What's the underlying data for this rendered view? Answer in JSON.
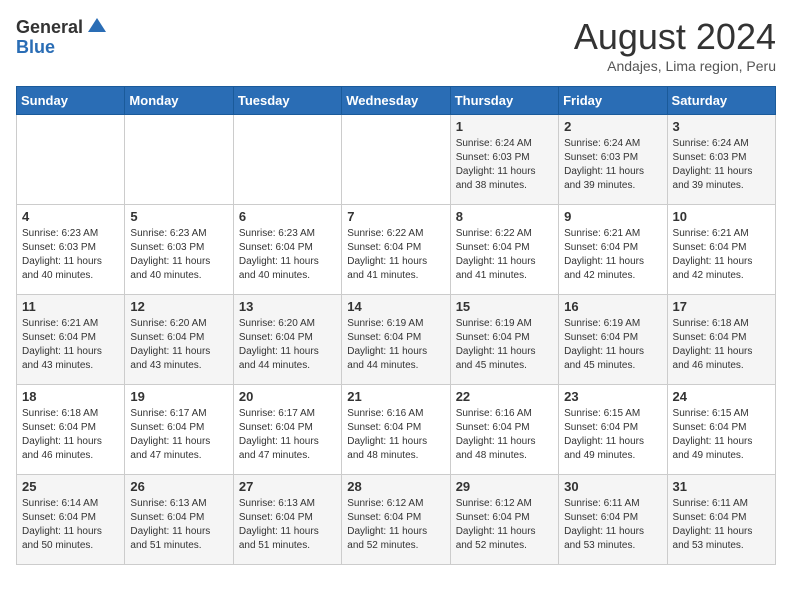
{
  "header": {
    "logo": {
      "line1": "General",
      "line2": "Blue"
    },
    "title": "August 2024",
    "location": "Andajes, Lima region, Peru"
  },
  "weekdays": [
    "Sunday",
    "Monday",
    "Tuesday",
    "Wednesday",
    "Thursday",
    "Friday",
    "Saturday"
  ],
  "weeks": [
    [
      {
        "day": "",
        "info": ""
      },
      {
        "day": "",
        "info": ""
      },
      {
        "day": "",
        "info": ""
      },
      {
        "day": "",
        "info": ""
      },
      {
        "day": "1",
        "info": "Sunrise: 6:24 AM\nSunset: 6:03 PM\nDaylight: 11 hours\nand 38 minutes."
      },
      {
        "day": "2",
        "info": "Sunrise: 6:24 AM\nSunset: 6:03 PM\nDaylight: 11 hours\nand 39 minutes."
      },
      {
        "day": "3",
        "info": "Sunrise: 6:24 AM\nSunset: 6:03 PM\nDaylight: 11 hours\nand 39 minutes."
      }
    ],
    [
      {
        "day": "4",
        "info": "Sunrise: 6:23 AM\nSunset: 6:03 PM\nDaylight: 11 hours\nand 40 minutes."
      },
      {
        "day": "5",
        "info": "Sunrise: 6:23 AM\nSunset: 6:03 PM\nDaylight: 11 hours\nand 40 minutes."
      },
      {
        "day": "6",
        "info": "Sunrise: 6:23 AM\nSunset: 6:04 PM\nDaylight: 11 hours\nand 40 minutes."
      },
      {
        "day": "7",
        "info": "Sunrise: 6:22 AM\nSunset: 6:04 PM\nDaylight: 11 hours\nand 41 minutes."
      },
      {
        "day": "8",
        "info": "Sunrise: 6:22 AM\nSunset: 6:04 PM\nDaylight: 11 hours\nand 41 minutes."
      },
      {
        "day": "9",
        "info": "Sunrise: 6:21 AM\nSunset: 6:04 PM\nDaylight: 11 hours\nand 42 minutes."
      },
      {
        "day": "10",
        "info": "Sunrise: 6:21 AM\nSunset: 6:04 PM\nDaylight: 11 hours\nand 42 minutes."
      }
    ],
    [
      {
        "day": "11",
        "info": "Sunrise: 6:21 AM\nSunset: 6:04 PM\nDaylight: 11 hours\nand 43 minutes."
      },
      {
        "day": "12",
        "info": "Sunrise: 6:20 AM\nSunset: 6:04 PM\nDaylight: 11 hours\nand 43 minutes."
      },
      {
        "day": "13",
        "info": "Sunrise: 6:20 AM\nSunset: 6:04 PM\nDaylight: 11 hours\nand 44 minutes."
      },
      {
        "day": "14",
        "info": "Sunrise: 6:19 AM\nSunset: 6:04 PM\nDaylight: 11 hours\nand 44 minutes."
      },
      {
        "day": "15",
        "info": "Sunrise: 6:19 AM\nSunset: 6:04 PM\nDaylight: 11 hours\nand 45 minutes."
      },
      {
        "day": "16",
        "info": "Sunrise: 6:19 AM\nSunset: 6:04 PM\nDaylight: 11 hours\nand 45 minutes."
      },
      {
        "day": "17",
        "info": "Sunrise: 6:18 AM\nSunset: 6:04 PM\nDaylight: 11 hours\nand 46 minutes."
      }
    ],
    [
      {
        "day": "18",
        "info": "Sunrise: 6:18 AM\nSunset: 6:04 PM\nDaylight: 11 hours\nand 46 minutes."
      },
      {
        "day": "19",
        "info": "Sunrise: 6:17 AM\nSunset: 6:04 PM\nDaylight: 11 hours\nand 47 minutes."
      },
      {
        "day": "20",
        "info": "Sunrise: 6:17 AM\nSunset: 6:04 PM\nDaylight: 11 hours\nand 47 minutes."
      },
      {
        "day": "21",
        "info": "Sunrise: 6:16 AM\nSunset: 6:04 PM\nDaylight: 11 hours\nand 48 minutes."
      },
      {
        "day": "22",
        "info": "Sunrise: 6:16 AM\nSunset: 6:04 PM\nDaylight: 11 hours\nand 48 minutes."
      },
      {
        "day": "23",
        "info": "Sunrise: 6:15 AM\nSunset: 6:04 PM\nDaylight: 11 hours\nand 49 minutes."
      },
      {
        "day": "24",
        "info": "Sunrise: 6:15 AM\nSunset: 6:04 PM\nDaylight: 11 hours\nand 49 minutes."
      }
    ],
    [
      {
        "day": "25",
        "info": "Sunrise: 6:14 AM\nSunset: 6:04 PM\nDaylight: 11 hours\nand 50 minutes."
      },
      {
        "day": "26",
        "info": "Sunrise: 6:13 AM\nSunset: 6:04 PM\nDaylight: 11 hours\nand 51 minutes."
      },
      {
        "day": "27",
        "info": "Sunrise: 6:13 AM\nSunset: 6:04 PM\nDaylight: 11 hours\nand 51 minutes."
      },
      {
        "day": "28",
        "info": "Sunrise: 6:12 AM\nSunset: 6:04 PM\nDaylight: 11 hours\nand 52 minutes."
      },
      {
        "day": "29",
        "info": "Sunrise: 6:12 AM\nSunset: 6:04 PM\nDaylight: 11 hours\nand 52 minutes."
      },
      {
        "day": "30",
        "info": "Sunrise: 6:11 AM\nSunset: 6:04 PM\nDaylight: 11 hours\nand 53 minutes."
      },
      {
        "day": "31",
        "info": "Sunrise: 6:11 AM\nSunset: 6:04 PM\nDaylight: 11 hours\nand 53 minutes."
      }
    ]
  ]
}
